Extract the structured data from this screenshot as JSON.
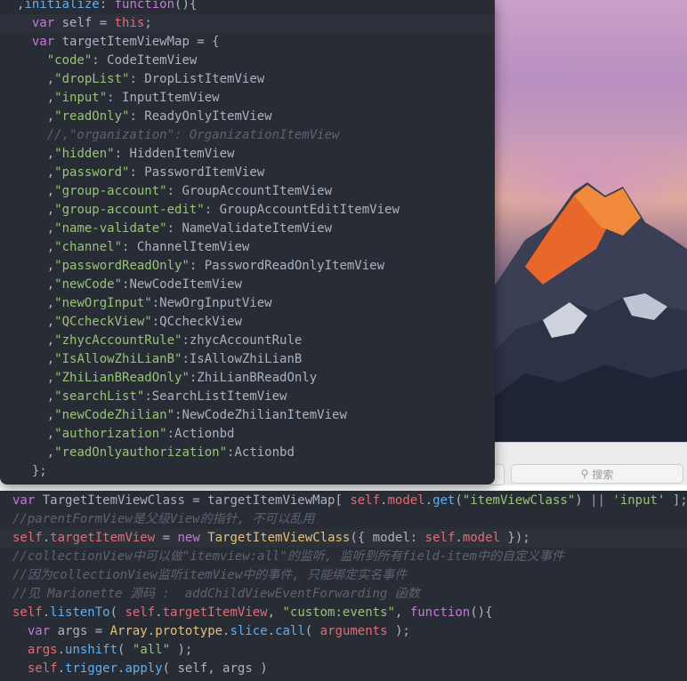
{
  "search": {
    "placeholder": "搜索"
  },
  "top_lines": [
    [
      {
        "t": ",",
        "c": "pl"
      },
      {
        "t": "initialize",
        "c": "fn"
      },
      {
        "t": ": ",
        "c": "pl"
      },
      {
        "t": "function",
        "c": "kw"
      },
      {
        "t": "(){",
        "c": "pl"
      }
    ],
    [
      {
        "t": "  ",
        "c": "pl"
      },
      {
        "t": "var",
        "c": "kw"
      },
      {
        "t": " self = ",
        "c": "pl"
      },
      {
        "t": "this",
        "c": "self"
      },
      {
        "t": ";",
        "c": "pl"
      }
    ],
    [
      {
        "t": "  ",
        "c": "pl"
      },
      {
        "t": "var",
        "c": "kw"
      },
      {
        "t": " targetItemViewMap = {",
        "c": "pl"
      }
    ],
    [
      {
        "t": "    ",
        "c": "pl"
      },
      {
        "t": "\"code\"",
        "c": "str"
      },
      {
        "t": ": CodeItemView",
        "c": "pl"
      }
    ],
    [
      {
        "t": "    ,",
        "c": "pl"
      },
      {
        "t": "\"dropList\"",
        "c": "str"
      },
      {
        "t": ": DropListItemView",
        "c": "pl"
      }
    ],
    [
      {
        "t": "    ,",
        "c": "pl"
      },
      {
        "t": "\"input\"",
        "c": "str"
      },
      {
        "t": ": InputItemView",
        "c": "pl"
      }
    ],
    [
      {
        "t": "    ,",
        "c": "pl"
      },
      {
        "t": "\"readOnly\"",
        "c": "str"
      },
      {
        "t": ": ReadyOnlyItemView",
        "c": "pl"
      }
    ],
    [
      {
        "t": "    //,\"organization\": OrganizationItemView",
        "c": "cm"
      }
    ],
    [
      {
        "t": "    ,",
        "c": "pl"
      },
      {
        "t": "\"hidden\"",
        "c": "str"
      },
      {
        "t": ": HiddenItemView",
        "c": "pl"
      }
    ],
    [
      {
        "t": "    ,",
        "c": "pl"
      },
      {
        "t": "\"password\"",
        "c": "str"
      },
      {
        "t": ": PasswordItemView",
        "c": "pl"
      }
    ],
    [
      {
        "t": "    ,",
        "c": "pl"
      },
      {
        "t": "\"group-account\"",
        "c": "str"
      },
      {
        "t": ": GroupAccountItemView",
        "c": "pl"
      }
    ],
    [
      {
        "t": "    ,",
        "c": "pl"
      },
      {
        "t": "\"group-account-edit\"",
        "c": "str"
      },
      {
        "t": ": GroupAccountEditItemView",
        "c": "pl"
      }
    ],
    [
      {
        "t": "    ,",
        "c": "pl"
      },
      {
        "t": "\"name-validate\"",
        "c": "str"
      },
      {
        "t": ": NameValidateItemView",
        "c": "pl"
      }
    ],
    [
      {
        "t": "    ,",
        "c": "pl"
      },
      {
        "t": "\"channel\"",
        "c": "str"
      },
      {
        "t": ": ChannelItemView",
        "c": "pl"
      }
    ],
    [
      {
        "t": "    ,",
        "c": "pl"
      },
      {
        "t": "\"passwordReadOnly\"",
        "c": "str"
      },
      {
        "t": ": PasswordReadOnlyItemView",
        "c": "pl"
      }
    ],
    [
      {
        "t": "    ,",
        "c": "pl"
      },
      {
        "t": "\"newCode\"",
        "c": "str"
      },
      {
        "t": ":NewCodeItemView",
        "c": "pl"
      }
    ],
    [
      {
        "t": "    ,",
        "c": "pl"
      },
      {
        "t": "\"newOrgInput\"",
        "c": "str"
      },
      {
        "t": ":NewOrgInputView",
        "c": "pl"
      }
    ],
    [
      {
        "t": "    ,",
        "c": "pl"
      },
      {
        "t": "\"QCcheckView\"",
        "c": "str"
      },
      {
        "t": ":QCcheckView",
        "c": "pl"
      }
    ],
    [
      {
        "t": "    ,",
        "c": "pl"
      },
      {
        "t": "\"zhycAccountRule\"",
        "c": "str"
      },
      {
        "t": ":zhycAccountRule",
        "c": "pl"
      }
    ],
    [
      {
        "t": "    ,",
        "c": "pl"
      },
      {
        "t": "\"IsAllowZhiLianB\"",
        "c": "str"
      },
      {
        "t": ":IsAllowZhiLianB",
        "c": "pl"
      }
    ],
    [
      {
        "t": "    ,",
        "c": "pl"
      },
      {
        "t": "\"ZhiLianBReadOnly\"",
        "c": "str"
      },
      {
        "t": ":ZhiLianBReadOnly",
        "c": "pl"
      }
    ],
    [
      {
        "t": "    ,",
        "c": "pl"
      },
      {
        "t": "\"searchList\"",
        "c": "str"
      },
      {
        "t": ":SearchListItemView",
        "c": "pl"
      }
    ],
    [
      {
        "t": "    ,",
        "c": "pl"
      },
      {
        "t": "\"newCodeZhilian\"",
        "c": "str"
      },
      {
        "t": ":NewCodeZhilianItemView",
        "c": "pl"
      }
    ],
    [
      {
        "t": "    ,",
        "c": "pl"
      },
      {
        "t": "\"authorization\"",
        "c": "str"
      },
      {
        "t": ":Actionbd",
        "c": "pl"
      }
    ],
    [
      {
        "t": "    ,",
        "c": "pl"
      },
      {
        "t": "\"readOnlyauthorization\"",
        "c": "str"
      },
      {
        "t": ":Actionbd",
        "c": "pl"
      }
    ],
    [
      {
        "t": "  };",
        "c": "pl"
      }
    ]
  ],
  "bottom_lines": [
    [
      {
        "t": "var",
        "c": "kw"
      },
      {
        "t": " TargetItemViewClass = targetItemViewMap[ ",
        "c": "pl"
      },
      {
        "t": "self",
        "c": "self"
      },
      {
        "t": ".",
        "c": "pl"
      },
      {
        "t": "model",
        "c": "self"
      },
      {
        "t": ".",
        "c": "pl"
      },
      {
        "t": "get",
        "c": "fn"
      },
      {
        "t": "(",
        "c": "pl"
      },
      {
        "t": "\"itemViewClass\"",
        "c": "str"
      },
      {
        "t": ") ",
        "c": "pl"
      },
      {
        "t": "||",
        "c": "kw"
      },
      {
        "t": " ",
        "c": "pl"
      },
      {
        "t": "'input'",
        "c": "str"
      },
      {
        "t": " ];",
        "c": "pl"
      }
    ],
    [
      {
        "t": "//parentFormView是父级View的指针, 不可以乱用",
        "c": "cm"
      }
    ],
    [
      {
        "t": "self",
        "c": "self"
      },
      {
        "t": ".",
        "c": "pl"
      },
      {
        "t": "targetItemView",
        "c": "self"
      },
      {
        "t": " = ",
        "c": "pl"
      },
      {
        "t": "new",
        "c": "kw"
      },
      {
        "t": " ",
        "c": "pl"
      },
      {
        "t": "TargetItemViewClass",
        "c": "cls"
      },
      {
        "t": "({ model: ",
        "c": "pl"
      },
      {
        "t": "self",
        "c": "self"
      },
      {
        "t": ".",
        "c": "pl"
      },
      {
        "t": "model",
        "c": "self"
      },
      {
        "t": " });",
        "c": "pl"
      }
    ],
    [
      {
        "t": "//collectionView中可以做\"itemview:all\"的监听, 监听到所有field-item中的自定义事件",
        "c": "cm"
      }
    ],
    [
      {
        "t": "//因为collectionView监听itemView中的事件, 只能绑定实名事件",
        "c": "cm"
      }
    ],
    [
      {
        "t": "//见 Marionette 源码 :  addChildViewEventForwarding 函数",
        "c": "cm"
      }
    ],
    [
      {
        "t": "self",
        "c": "self"
      },
      {
        "t": ".",
        "c": "pl"
      },
      {
        "t": "listenTo",
        "c": "fn"
      },
      {
        "t": "( ",
        "c": "pl"
      },
      {
        "t": "self",
        "c": "self"
      },
      {
        "t": ".",
        "c": "pl"
      },
      {
        "t": "targetItemView",
        "c": "self"
      },
      {
        "t": ", ",
        "c": "pl"
      },
      {
        "t": "\"custom:events\"",
        "c": "str"
      },
      {
        "t": ", ",
        "c": "pl"
      },
      {
        "t": "function",
        "c": "kw"
      },
      {
        "t": "(){",
        "c": "pl"
      }
    ],
    [
      {
        "t": "  ",
        "c": "pl"
      },
      {
        "t": "var",
        "c": "kw"
      },
      {
        "t": " args = ",
        "c": "pl"
      },
      {
        "t": "Array",
        "c": "cls"
      },
      {
        "t": ".",
        "c": "pl"
      },
      {
        "t": "prototype",
        "c": "cls"
      },
      {
        "t": ".",
        "c": "pl"
      },
      {
        "t": "slice",
        "c": "fn"
      },
      {
        "t": ".",
        "c": "pl"
      },
      {
        "t": "call",
        "c": "fn"
      },
      {
        "t": "( ",
        "c": "pl"
      },
      {
        "t": "arguments",
        "c": "self"
      },
      {
        "t": " );",
        "c": "pl"
      }
    ],
    [
      {
        "t": "  ",
        "c": "pl"
      },
      {
        "t": "args",
        "c": "self"
      },
      {
        "t": ".",
        "c": "pl"
      },
      {
        "t": "unshift",
        "c": "fn"
      },
      {
        "t": "( ",
        "c": "pl"
      },
      {
        "t": "\"all\"",
        "c": "str"
      },
      {
        "t": " );",
        "c": "pl"
      }
    ],
    [
      {
        "t": "  ",
        "c": "pl"
      },
      {
        "t": "self",
        "c": "self"
      },
      {
        "t": ".",
        "c": "pl"
      },
      {
        "t": "trigger",
        "c": "fn"
      },
      {
        "t": ".",
        "c": "pl"
      },
      {
        "t": "apply",
        "c": "fn"
      },
      {
        "t": "( self, args )",
        "c": "pl"
      }
    ]
  ],
  "colors": {
    "editor_bg": "#282c34",
    "keyword": "#c678dd",
    "string": "#98c379",
    "function": "#61afef",
    "variable": "#e06c75",
    "class": "#e5c07b",
    "comment": "#5c6370"
  }
}
